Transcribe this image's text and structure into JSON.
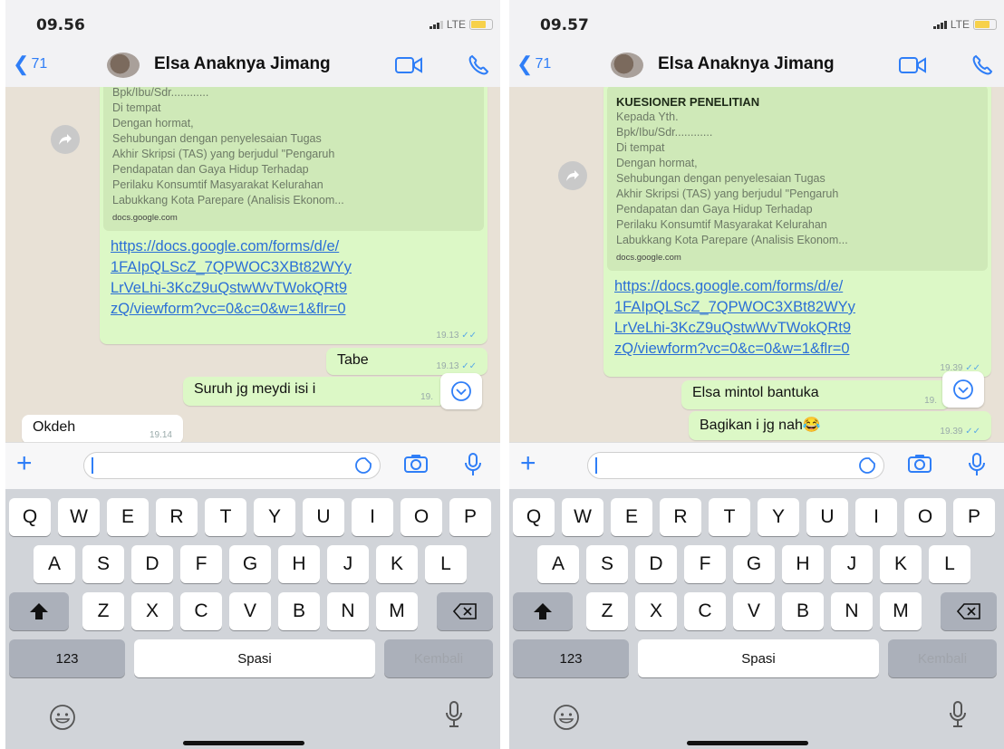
{
  "screens": [
    {
      "status": {
        "time": "09.56",
        "network": "LTE"
      },
      "header": {
        "back_count": "71",
        "contact_name": "Elsa Anaknya Jimang"
      },
      "preview": {
        "title": "",
        "lines": [
          "Bpk/Ibu/Sdr............",
          "Di tempat",
          "Dengan hormat,",
          "Sehubungan dengan penyelesaian Tugas",
          "Akhir Skripsi (TAS) yang berjudul \"Pengaruh",
          "Pendapatan dan Gaya Hidup Terhadap",
          "Perilaku Konsumtif Masyarakat Kelurahan",
          "Labukkang Kota Parepare (Analisis Ekonom..."
        ],
        "domain": "docs.google.com"
      },
      "link": {
        "lines": [
          "https://docs.google.com/forms/d/e/",
          "1FAIpQLScZ_7QPWOC3XBt82WYy",
          "LrVeLhi-3KcZ9uQstwWvTWokQRt9",
          "zQ/viewform?vc=0&c=0&w=1&flr=0"
        ],
        "time": "19.13"
      },
      "messages": [
        {
          "text": "Tabe",
          "time": "19.13"
        },
        {
          "text": "Suruh jg meydi isi i",
          "time": "19."
        },
        {
          "text": "Okdeh",
          "time": "19.14"
        }
      ]
    },
    {
      "status": {
        "time": "09.57",
        "network": "LTE"
      },
      "header": {
        "back_count": "71",
        "contact_name": "Elsa Anaknya Jimang"
      },
      "preview": {
        "title": "KUESIONER PENELITIAN",
        "lines": [
          "Kepada Yth.",
          "Bpk/Ibu/Sdr............",
          "Di tempat",
          "Dengan hormat,",
          "Sehubungan dengan penyelesaian Tugas",
          "Akhir Skripsi (TAS) yang berjudul \"Pengaruh",
          "Pendapatan dan Gaya Hidup Terhadap",
          "Perilaku Konsumtif Masyarakat Kelurahan",
          "Labukkang Kota Parepare (Analisis Ekonom..."
        ],
        "domain": "docs.google.com"
      },
      "link": {
        "lines": [
          "https://docs.google.com/forms/d/e/",
          "1FAIpQLScZ_7QPWOC3XBt82WYy",
          "LrVeLhi-3KcZ9uQstwWvTWokQRt9",
          "zQ/viewform?vc=0&c=0&w=1&flr=0"
        ],
        "time": "19.39"
      },
      "messages": [
        {
          "text": "Elsa mintol bantuka",
          "time": "19."
        },
        {
          "text": "Bagikan i jg nah😂",
          "time": "19.39"
        }
      ]
    }
  ],
  "keyboard": {
    "row1": [
      "Q",
      "W",
      "E",
      "R",
      "T",
      "Y",
      "U",
      "I",
      "O",
      "P"
    ],
    "row2": [
      "A",
      "S",
      "D",
      "F",
      "G",
      "H",
      "J",
      "K",
      "L"
    ],
    "row3": [
      "Z",
      "X",
      "C",
      "V",
      "B",
      "N",
      "M"
    ],
    "numbers_label": "123",
    "space_label": "Spasi",
    "return_label": "Kembali"
  },
  "icons": {
    "back": "chevron-left-icon",
    "video": "video-call-icon",
    "call": "phone-icon",
    "plus": "plus-icon",
    "sticker": "sticker-icon",
    "camera": "camera-icon",
    "mic": "microphone-icon",
    "emoji": "emoji-icon",
    "shift": "shift-icon",
    "backspace": "backspace-icon",
    "forward": "forward-icon",
    "scroll_down": "scroll-down-icon"
  },
  "colors": {
    "accent": "#2f7ef7",
    "outgoing_bubble": "#dcf8c6",
    "link": "#2b6fd6",
    "chat_bg": "#e8e1d6"
  }
}
